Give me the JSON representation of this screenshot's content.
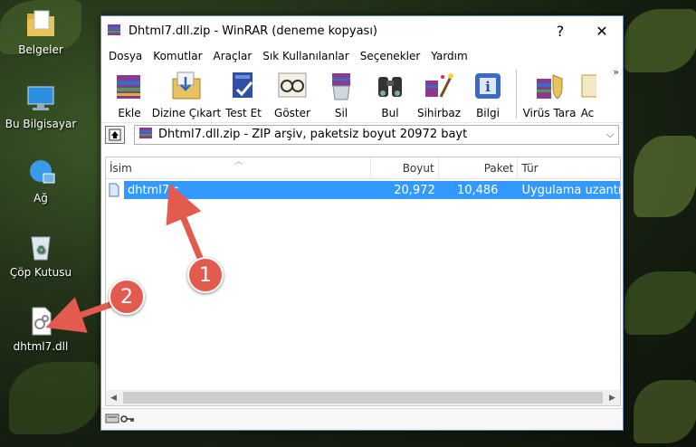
{
  "desktop": {
    "icons": [
      {
        "label": "Belgeler",
        "icon": "folder-icon"
      },
      {
        "label": "Bu Bilgisayar",
        "icon": "computer-icon"
      },
      {
        "label": "Ağ",
        "icon": "network-icon"
      },
      {
        "label": "Çöp Kutusu",
        "icon": "recycle-bin-icon"
      },
      {
        "label": "dhtml7.dll",
        "icon": "dll-file-icon"
      }
    ]
  },
  "window": {
    "title": "Dhtml7.dll.zip - WinRAR (deneme kopyası)",
    "help_glyph": "?",
    "close_glyph": "✕",
    "menu": [
      "Dosya",
      "Komutlar",
      "Araçlar",
      "Sık Kullanılanlar",
      "Seçenekler",
      "Yardım"
    ],
    "toolbar": [
      {
        "label": "Ekle",
        "icon": "add-archive-icon"
      },
      {
        "label": "Dizine Çıkart",
        "icon": "extract-to-icon"
      },
      {
        "label": "Test Et",
        "icon": "test-icon"
      },
      {
        "label": "Göster",
        "icon": "view-icon"
      },
      {
        "label": "Sil",
        "icon": "delete-icon"
      },
      {
        "label": "Bul",
        "icon": "find-icon"
      },
      {
        "label": "Sihirbaz",
        "icon": "wizard-icon"
      },
      {
        "label": "Bilgi",
        "icon": "info-icon"
      },
      {
        "label": "Virüs Tara",
        "icon": "virus-scan-icon"
      },
      {
        "label": "Ac",
        "icon": "comment-icon"
      }
    ],
    "toolbar_more": "»",
    "address": "Dhtml7.dll.zip - ZIP arşiv, paketsiz boyut 20972 bayt",
    "columns": [
      "İsim",
      "Boyut",
      "Paket",
      "Tür"
    ],
    "files": [
      {
        "name": "dhtml7.dll",
        "size": "20,972",
        "packed": "10,486",
        "type": "Uygulama uzantısı"
      }
    ]
  },
  "annotations": {
    "badge1": "1",
    "badge2": "2"
  },
  "colors": {
    "selection": "#3399ff",
    "badge": "#e25b4e",
    "arrow": "#e25b4e"
  }
}
